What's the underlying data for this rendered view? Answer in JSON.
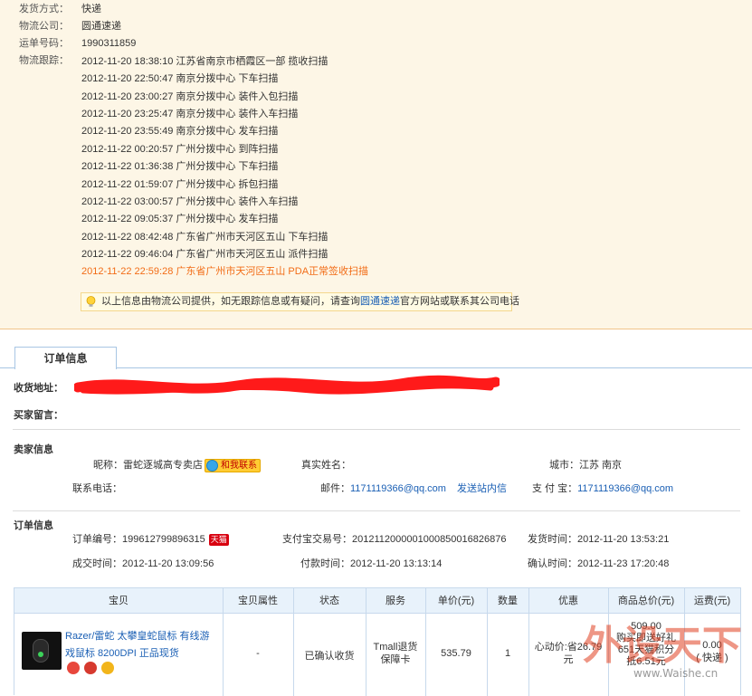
{
  "shipping": {
    "method_label": "发货方式：",
    "method_value": "快递",
    "company_label": "物流公司：",
    "company_value": "圆通速递",
    "tracking_no_label": "运单号码：",
    "tracking_no_value": "1990311859",
    "tracking_label": "物流跟踪：",
    "events": [
      {
        "text": "2012-11-20 18:38:10 江苏省南京市栖霞区一部 揽收扫描"
      },
      {
        "text": "2012-11-20 22:50:47 南京分拨中心 下车扫描"
      },
      {
        "text": "2012-11-20 23:00:27 南京分拨中心 装件入包扫描"
      },
      {
        "text": "2012-11-20 23:25:47 南京分拨中心 装件入车扫描"
      },
      {
        "text": "2012-11-20 23:55:49 南京分拨中心 发车扫描"
      },
      {
        "text": "2012-11-22 00:20:57 广州分拨中心 到阵扫描"
      },
      {
        "text": "2012-11-22 01:36:38 广州分拨中心 下车扫描"
      },
      {
        "text": "2012-11-22 01:59:07 广州分拨中心 拆包扫描"
      },
      {
        "text": "2012-11-22 03:00:57 广州分拨中心 装件入车扫描"
      },
      {
        "text": "2012-11-22 09:05:37 广州分拨中心 发车扫描"
      },
      {
        "text": "2012-11-22 08:42:48 广东省广州市天河区五山 下车扫描"
      },
      {
        "text": "2012-11-22 09:46:04 广东省广州市天河区五山 派件扫描"
      },
      {
        "text": "2012-11-22 22:59:28 广东省广州市天河区五山 PDA正常签收扫描"
      }
    ],
    "tip_before": "以上信息由物流公司提供，如无跟踪信息或有疑问，请查询",
    "tip_link": "圆通速递",
    "tip_after": "官方网站或联系其公司电话"
  },
  "order_tab": "订单信息",
  "receiver": {
    "address_label": "收货地址：",
    "message_label": "买家留言："
  },
  "seller": {
    "section_label": "卖家信息",
    "nick_label": "昵称：",
    "nick_value": "雷蛇逐城高专卖店",
    "contact_badge": "和我联系",
    "realname_label": "真实姓名：",
    "city_label": "城市：",
    "city_value": "江苏 南京",
    "phone_label": "联系电话：",
    "email_label": "邮件：",
    "email_value": "1171119366@qq.com",
    "message_link": "发送站内信",
    "alipay_label": "支 付 宝：",
    "alipay_value": "1171119366@qq.com"
  },
  "order": {
    "section_label": "订单信息",
    "no_label": "订单编号：",
    "no_value": "199612799896315",
    "tmall_badge": "天猫",
    "alipay_no_label": "支付宝交易号：",
    "alipay_no_value": "2012112000001000850016826876",
    "ship_time_label": "发货时间：",
    "ship_time_value": "2012-11-20 13:53:21",
    "deal_time_label": "成交时间：",
    "deal_time_value": "2012-11-20 13:09:56",
    "pay_time_label": "付款时间：",
    "pay_time_value": "2012-11-20 13:13:14",
    "confirm_time_label": "确认时间：",
    "confirm_time_value": "2012-11-23 17:20:48"
  },
  "table": {
    "headers": [
      "宝贝",
      "宝贝属性",
      "状态",
      "服务",
      "单价(元)",
      "数量",
      "优惠",
      "商品总价(元)",
      "运费(元)"
    ],
    "row": {
      "title": "Razer/雷蛇 太攀皇蛇鼠标 有线游戏鼠标 8200DPI 正品现货",
      "attr": "-",
      "status": "已确认收货",
      "service": "Tmall退货保障卡",
      "price": "535.79",
      "qty": "1",
      "discount": "心动价:省26.79元",
      "total_line1": "509.00",
      "total_line2": "购买即送好礼",
      "total_line3": "651天猫积分",
      "total_line4": "抵6.51元",
      "freight": "0.00",
      "freight_note": "( 快递 )"
    }
  },
  "watermark": {
    "text": "外设天下",
    "url": "www.Waishe.cn"
  },
  "colors": {
    "panel_bg": "#fdf6e6",
    "latest_event": "#f26c16",
    "link": "#1a5fb4",
    "table_header_bg": "#e8f2fb"
  }
}
